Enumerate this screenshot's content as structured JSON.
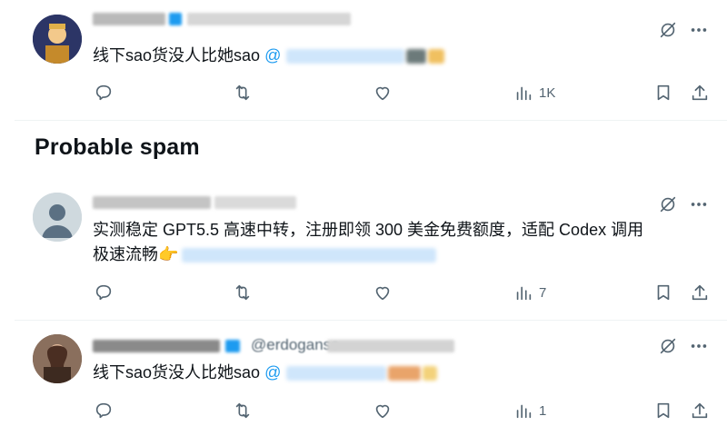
{
  "tweets": [
    {
      "text": "线下sao货没人比她sao",
      "mention_prefix": "@",
      "views": "1K"
    },
    {
      "text_line1": "实测稳定 GPT5.5 高速中转，注册即领 300 美金免费额度，适配 Codex 调用",
      "text_line2": "极速流畅",
      "emoji": "👉",
      "views": "7"
    },
    {
      "handle_visible": "@erdoganse",
      "text": "线下sao货没人比她sao",
      "mention_prefix": "@",
      "views": "1"
    }
  ],
  "section_heading": "Probable spam",
  "colors": {
    "accent": "#1d9bf0",
    "icon_gray": "#536471",
    "text": "#0f1419",
    "separator": "#eff3f4"
  },
  "icons": [
    "grok-icon",
    "more-icon",
    "reply-icon",
    "retweet-icon",
    "like-icon",
    "views-icon",
    "bookmark-icon",
    "share-icon"
  ]
}
